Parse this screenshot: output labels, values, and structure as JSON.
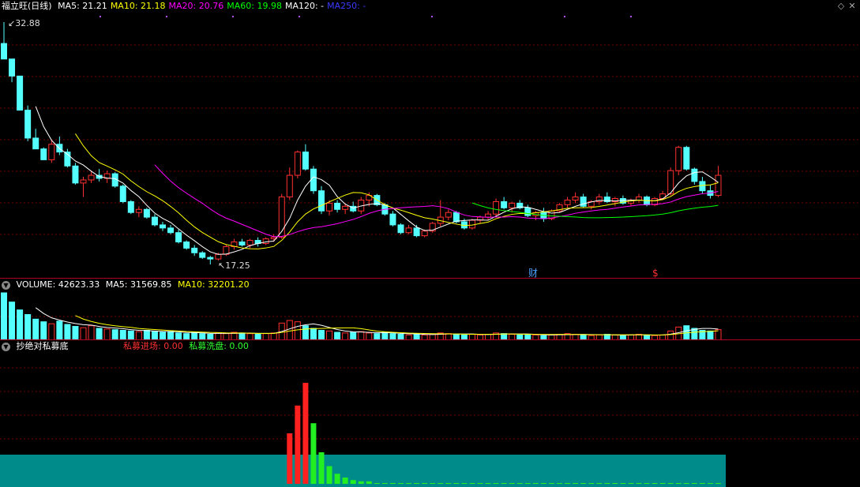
{
  "main": {
    "stock_title": "福立旺(日线)",
    "ma_labels": [
      {
        "text": "MA5: 21.21",
        "color": "#ffffff"
      },
      {
        "text": "MA10: 21.18",
        "color": "#ffff00"
      },
      {
        "text": "MA20: 20.76",
        "color": "#ff00ff"
      },
      {
        "text": "MA60: 19.98",
        "color": "#00ff00"
      },
      {
        "text": "MA120: -",
        "color": "#ffffff"
      },
      {
        "text": "MA250: -",
        "color": "#3a3aff"
      }
    ],
    "high_label": "32.88",
    "low_label": "17.25",
    "marker_finance": "财",
    "marker_dollar": "$"
  },
  "volume": {
    "title": "VOLUME: 42623.33",
    "ma5": "MA5: 31569.85",
    "ma10": "MA10: 32201.20"
  },
  "indicator": {
    "title": "抄绝对私募底",
    "label1": "私募进场: 0.00",
    "label2": "私募洗盘: 0.00"
  },
  "colors": {
    "up": "#ff3030",
    "down": "#54ffff",
    "grid": "#7a0000",
    "teal": "#008b8b"
  },
  "chart_data": {
    "type": "candlestick",
    "price_range": [
      17.25,
      32.88
    ],
    "candles": [
      [
        31.5,
        32.88,
        30.5,
        30.5
      ],
      [
        30.5,
        30.5,
        29.0,
        29.4
      ],
      [
        29.4,
        29.4,
        27.2,
        27.2
      ],
      [
        27.2,
        27.5,
        25.2,
        25.4
      ],
      [
        25.4,
        26.0,
        24.7,
        24.7
      ],
      [
        24.7,
        24.8,
        24.0,
        24.0
      ],
      [
        24.0,
        25.3,
        23.8,
        25.0
      ],
      [
        25.0,
        25.5,
        24.3,
        24.5
      ],
      [
        24.5,
        24.7,
        23.5,
        23.6
      ],
      [
        23.6,
        23.8,
        22.4,
        22.5
      ],
      [
        22.5,
        22.9,
        21.6,
        22.7
      ],
      [
        22.7,
        23.3,
        22.5,
        23.0
      ],
      [
        23.0,
        23.4,
        22.6,
        22.8
      ],
      [
        22.8,
        23.3,
        22.5,
        23.1
      ],
      [
        23.1,
        23.2,
        22.2,
        22.3
      ],
      [
        22.3,
        22.4,
        21.2,
        21.3
      ],
      [
        21.3,
        21.4,
        20.5,
        20.6
      ],
      [
        20.6,
        21.0,
        20.3,
        20.8
      ],
      [
        20.8,
        20.9,
        20.2,
        20.3
      ],
      [
        20.3,
        20.5,
        19.7,
        19.8
      ],
      [
        19.8,
        20.0,
        19.4,
        19.6
      ],
      [
        19.6,
        19.8,
        19.2,
        19.3
      ],
      [
        19.3,
        19.5,
        18.6,
        18.7
      ],
      [
        18.7,
        18.8,
        18.2,
        18.3
      ],
      [
        18.3,
        18.5,
        17.8,
        18.0
      ],
      [
        18.0,
        18.1,
        17.6,
        17.7
      ],
      [
        17.7,
        17.8,
        17.25,
        17.6
      ],
      [
        17.6,
        18.0,
        17.5,
        17.9
      ],
      [
        17.9,
        18.5,
        17.8,
        18.4
      ],
      [
        18.4,
        18.9,
        18.2,
        18.7
      ],
      [
        18.7,
        18.9,
        18.4,
        18.5
      ],
      [
        18.5,
        18.9,
        18.3,
        18.8
      ],
      [
        18.8,
        19.0,
        18.4,
        18.6
      ],
      [
        18.6,
        19.0,
        18.5,
        18.9
      ],
      [
        18.9,
        19.2,
        18.7,
        19.0
      ],
      [
        19.0,
        21.8,
        18.9,
        21.6
      ],
      [
        21.6,
        23.5,
        21.4,
        23.0
      ],
      [
        23.0,
        24.6,
        22.8,
        24.5
      ],
      [
        24.5,
        25.0,
        23.3,
        23.4
      ],
      [
        23.4,
        23.6,
        21.8,
        22.0
      ],
      [
        22.0,
        22.3,
        20.5,
        20.7
      ],
      [
        20.7,
        21.4,
        20.4,
        21.2
      ],
      [
        21.2,
        21.4,
        20.6,
        20.8
      ],
      [
        20.8,
        21.2,
        20.5,
        21.0
      ],
      [
        21.0,
        21.3,
        20.6,
        20.7
      ],
      [
        20.7,
        21.6,
        20.5,
        21.4
      ],
      [
        21.4,
        21.9,
        21.0,
        21.7
      ],
      [
        21.7,
        21.8,
        21.0,
        21.1
      ],
      [
        21.1,
        21.2,
        20.4,
        20.5
      ],
      [
        20.5,
        20.7,
        19.7,
        19.8
      ],
      [
        19.8,
        19.9,
        19.2,
        19.3
      ],
      [
        19.3,
        19.8,
        19.2,
        19.6
      ],
      [
        19.6,
        19.8,
        19.0,
        19.1
      ],
      [
        19.1,
        19.5,
        19.0,
        19.4
      ],
      [
        19.4,
        20.0,
        19.3,
        19.9
      ],
      [
        19.9,
        21.4,
        19.7,
        20.3
      ],
      [
        20.3,
        20.8,
        20.1,
        20.6
      ],
      [
        20.6,
        20.7,
        19.9,
        20.0
      ],
      [
        20.0,
        20.2,
        19.5,
        19.6
      ],
      [
        19.6,
        20.2,
        19.5,
        20.1
      ],
      [
        20.1,
        20.4,
        19.9,
        20.3
      ],
      [
        20.3,
        20.7,
        20.1,
        20.5
      ],
      [
        20.5,
        21.5,
        20.3,
        21.3
      ],
      [
        21.3,
        21.6,
        20.8,
        20.9
      ],
      [
        20.9,
        21.3,
        20.6,
        21.2
      ],
      [
        21.2,
        21.4,
        20.8,
        20.9
      ],
      [
        20.9,
        21.1,
        20.3,
        20.4
      ],
      [
        20.4,
        20.7,
        20.1,
        20.6
      ],
      [
        20.6,
        20.9,
        20.0,
        20.2
      ],
      [
        20.2,
        20.8,
        20.1,
        20.7
      ],
      [
        20.7,
        21.2,
        20.6,
        21.1
      ],
      [
        21.1,
        21.6,
        20.9,
        21.4
      ],
      [
        21.4,
        21.9,
        21.2,
        21.6
      ],
      [
        21.6,
        21.8,
        20.9,
        21.0
      ],
      [
        21.0,
        21.4,
        20.8,
        21.3
      ],
      [
        21.3,
        21.8,
        21.1,
        21.6
      ],
      [
        21.6,
        21.9,
        21.2,
        21.3
      ],
      [
        21.3,
        21.6,
        21.0,
        21.5
      ],
      [
        21.5,
        21.7,
        21.1,
        21.2
      ],
      [
        21.2,
        21.5,
        21.0,
        21.4
      ],
      [
        21.4,
        21.8,
        21.2,
        21.6
      ],
      [
        21.6,
        21.7,
        21.0,
        21.1
      ],
      [
        21.1,
        21.6,
        21.0,
        21.5
      ],
      [
        21.5,
        22.0,
        21.4,
        21.8
      ],
      [
        21.8,
        23.5,
        21.7,
        23.3
      ],
      [
        23.3,
        24.9,
        23.0,
        24.8
      ],
      [
        24.8,
        24.9,
        23.3,
        23.4
      ],
      [
        23.4,
        23.5,
        22.4,
        22.6
      ],
      [
        22.6,
        22.9,
        21.8,
        22.0
      ],
      [
        22.0,
        22.4,
        21.5,
        21.7
      ],
      [
        21.7,
        23.6,
        21.6,
        23.0
      ]
    ],
    "ma_series": [
      "MA5",
      "MA10",
      "MA20",
      "MA60"
    ],
    "volume_values": [
      7.2,
      5.8,
      4.6,
      3.9,
      3.2,
      2.8,
      2.5,
      2.9,
      2.4,
      2.1,
      1.9,
      2.2,
      1.8,
      1.7,
      1.6,
      1.5,
      1.4,
      1.3,
      1.5,
      1.3,
      1.2,
      1.3,
      1.1,
      1.0,
      1.2,
      1.0,
      0.9,
      1.1,
      1.0,
      1.2,
      1.1,
      1.0,
      0.9,
      1.0,
      1.1,
      2.6,
      3.0,
      2.8,
      2.2,
      1.8,
      1.5,
      1.4,
      1.2,
      1.1,
      1.2,
      1.3,
      1.1,
      1.0,
      1.2,
      1.0,
      0.9,
      0.8,
      0.9,
      0.8,
      0.9,
      1.1,
      1.0,
      0.9,
      0.8,
      0.9,
      0.8,
      0.9,
      1.1,
      1.0,
      0.9,
      0.8,
      0.9,
      0.8,
      0.7,
      0.8,
      0.9,
      1.0,
      0.9,
      0.8,
      0.7,
      0.8,
      0.9,
      0.8,
      0.7,
      0.8,
      0.9,
      0.8,
      0.7,
      0.8,
      1.4,
      2.0,
      2.2,
      1.8,
      1.5,
      1.4,
      1.6
    ],
    "indicator_red": [
      [
        36,
        40
      ],
      [
        37,
        62
      ],
      [
        38,
        80
      ]
    ],
    "indicator_green": [
      [
        39,
        48
      ],
      [
        40,
        25
      ],
      [
        41,
        14
      ],
      [
        42,
        8
      ],
      [
        43,
        5
      ],
      [
        44,
        3
      ],
      [
        45,
        2
      ],
      [
        46,
        2
      ]
    ]
  }
}
